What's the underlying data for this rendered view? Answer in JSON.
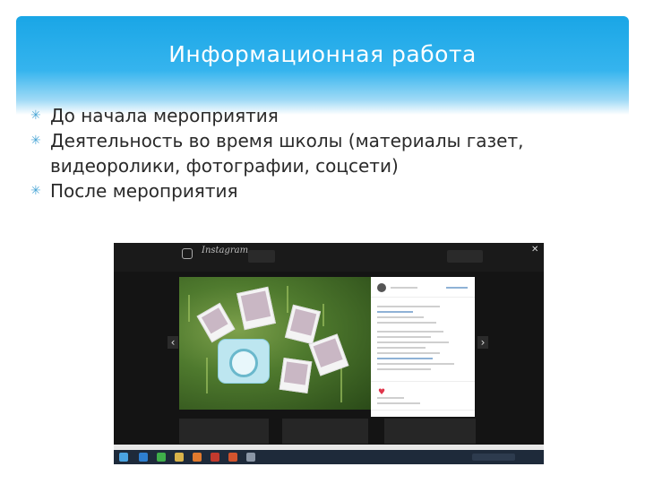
{
  "slide": {
    "title": "Информационная работа",
    "bullets": [
      {
        "text": "До начала мероприятия"
      },
      {
        "text": "Деятельность во время школы (материалы газет, видеоролики, фотографии, соцсети)"
      },
      {
        "text": "После мероприятия"
      }
    ]
  },
  "screenshot": {
    "app_name": "Instagram",
    "close_glyph": "✕",
    "prev_glyph": "‹",
    "next_glyph": "›",
    "heart_glyph": "♥",
    "taskbar_icons": [
      "windows-icon",
      "ie-icon",
      "chrome-icon",
      "folder-icon",
      "media-icon",
      "mail-icon",
      "powerpoint-icon",
      "settings-icon"
    ]
  }
}
